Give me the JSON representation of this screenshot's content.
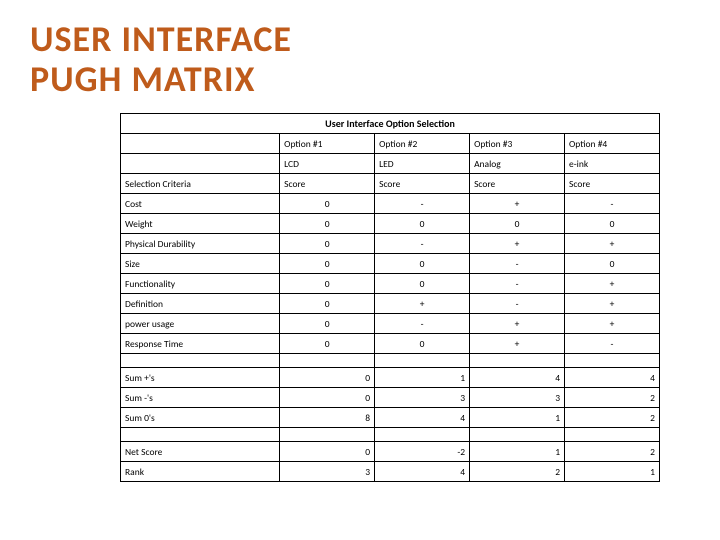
{
  "title_line1": "USER INTERFACE",
  "title_line2": "PUGH MATRIX",
  "table": {
    "caption": "User Interface Option Selection",
    "option_headers": [
      "Option #1",
      "Option #2",
      "Option #3",
      "Option #4"
    ],
    "option_types": [
      "LCD",
      "LED",
      "Analog",
      "e-ink"
    ],
    "criteria_header": "Selection Criteria",
    "score_header": "Score",
    "criteria": [
      {
        "name": "Cost",
        "scores": [
          "0",
          "-",
          "+",
          "-"
        ]
      },
      {
        "name": "Weight",
        "scores": [
          "0",
          "0",
          "0",
          "0"
        ]
      },
      {
        "name": "Physical Durability",
        "scores": [
          "0",
          "-",
          "+",
          "+"
        ]
      },
      {
        "name": "Size",
        "scores": [
          "0",
          "0",
          "-",
          "0"
        ]
      },
      {
        "name": "Functionality",
        "scores": [
          "0",
          "0",
          "-",
          "+"
        ]
      },
      {
        "name": "Definition",
        "scores": [
          "0",
          "+",
          "-",
          "+"
        ]
      },
      {
        "name": "power usage",
        "scores": [
          "0",
          "-",
          "+",
          "+"
        ]
      },
      {
        "name": "Response Time",
        "scores": [
          "0",
          "0",
          "+",
          "-"
        ]
      }
    ],
    "sums": [
      {
        "label": "Sum +'s",
        "values": [
          "0",
          "1",
          "4",
          "4"
        ]
      },
      {
        "label": "Sum -'s",
        "values": [
          "0",
          "3",
          "3",
          "2"
        ]
      },
      {
        "label": "Sum 0's",
        "values": [
          "8",
          "4",
          "1",
          "2"
        ]
      }
    ],
    "footer": [
      {
        "label": "Net Score",
        "values": [
          "0",
          "-2",
          "1",
          "2"
        ]
      },
      {
        "label": "Rank",
        "values": [
          "3",
          "4",
          "2",
          "1"
        ]
      }
    ]
  },
  "chart_data": {
    "type": "table",
    "title": "User Interface Option Selection — Pugh Matrix",
    "options": [
      {
        "id": "Option #1",
        "tech": "LCD",
        "sum_plus": 0,
        "sum_minus": 0,
        "sum_zero": 8,
        "net_score": 0,
        "rank": 3
      },
      {
        "id": "Option #2",
        "tech": "LED",
        "sum_plus": 1,
        "sum_minus": 3,
        "sum_zero": 4,
        "net_score": -2,
        "rank": 4
      },
      {
        "id": "Option #3",
        "tech": "Analog",
        "sum_plus": 4,
        "sum_minus": 3,
        "sum_zero": 1,
        "net_score": 1,
        "rank": 2
      },
      {
        "id": "Option #4",
        "tech": "e-ink",
        "sum_plus": 4,
        "sum_minus": 2,
        "sum_zero": 2,
        "net_score": 2,
        "rank": 1
      }
    ],
    "criteria_scores": {
      "Cost": [
        "0",
        "-",
        "+",
        "-"
      ],
      "Weight": [
        "0",
        "0",
        "0",
        "0"
      ],
      "Physical Durability": [
        "0",
        "-",
        "+",
        "+"
      ],
      "Size": [
        "0",
        "0",
        "-",
        "0"
      ],
      "Functionality": [
        "0",
        "0",
        "-",
        "+"
      ],
      "Definition": [
        "0",
        "+",
        "-",
        "+"
      ],
      "power usage": [
        "0",
        "-",
        "+",
        "+"
      ],
      "Response Time": [
        "0",
        "0",
        "+",
        "-"
      ]
    }
  }
}
